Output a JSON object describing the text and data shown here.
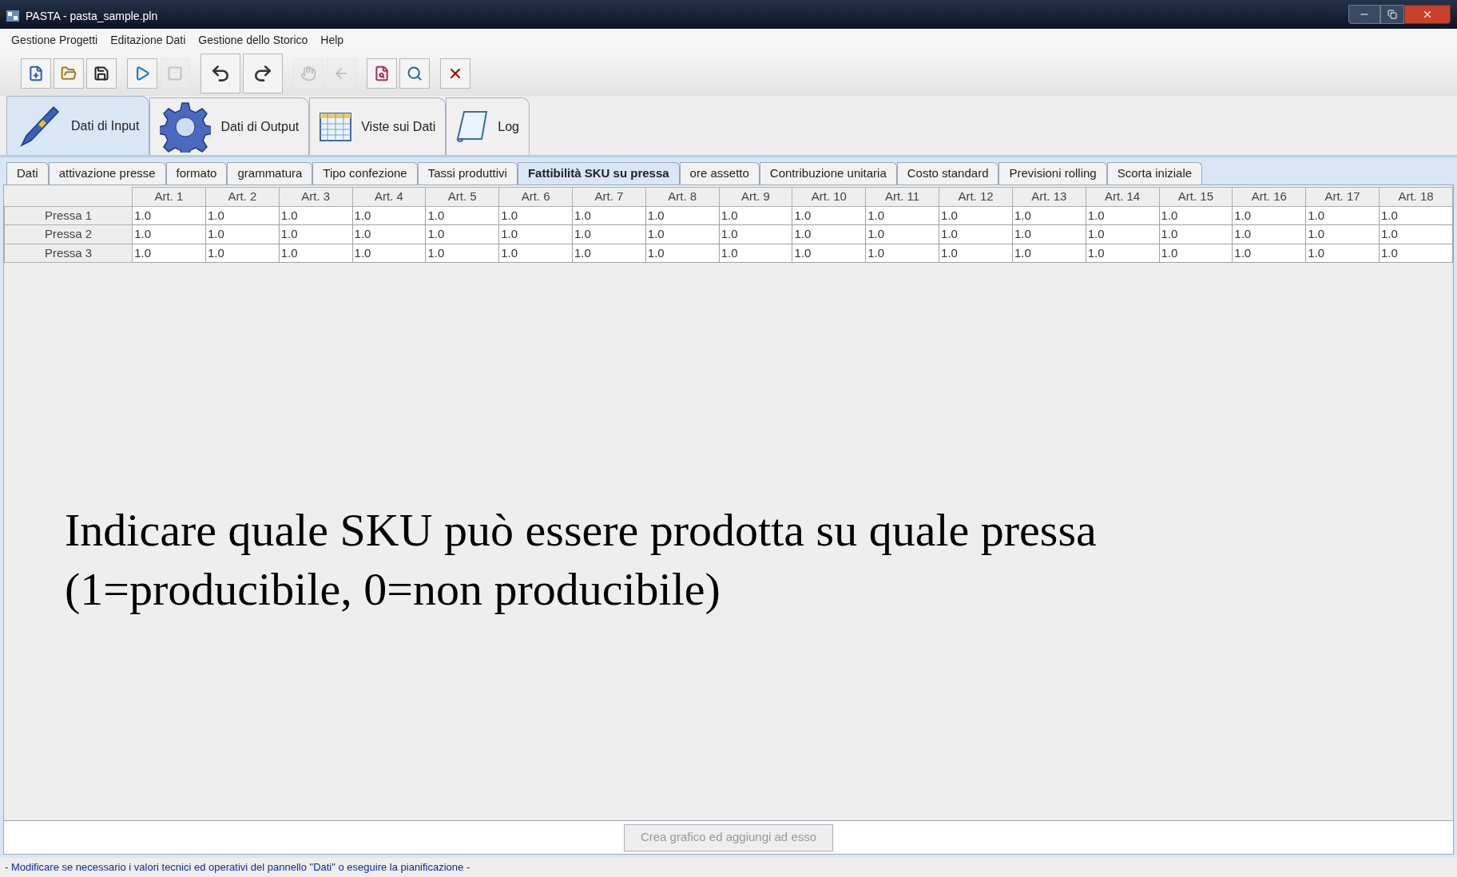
{
  "window": {
    "title": "PASTA - pasta_sample.pln"
  },
  "menu": [
    "Gestione Progetti",
    "Editazione Dati",
    "Gestione dello Storico",
    "Help"
  ],
  "toolbar": [
    {
      "kind": "new",
      "disabled": false
    },
    {
      "kind": "open",
      "disabled": false
    },
    {
      "kind": "save",
      "disabled": false
    },
    {
      "kind": "run",
      "disabled": false
    },
    {
      "kind": "stop",
      "disabled": true
    },
    {
      "kind": "undo",
      "disabled": false
    },
    {
      "kind": "redo",
      "disabled": false
    },
    {
      "kind": "back",
      "disabled": true
    },
    {
      "kind": "forward",
      "disabled": true
    },
    {
      "kind": "preview",
      "disabled": false
    },
    {
      "kind": "search",
      "disabled": false
    },
    {
      "kind": "close",
      "disabled": false
    }
  ],
  "main_tabs": [
    {
      "label": "Dati di Input",
      "kind": "pen",
      "selected": true
    },
    {
      "label": "Dati di Output",
      "kind": "gear",
      "selected": false
    },
    {
      "label": "Viste sui Dati",
      "kind": "grid",
      "selected": false
    },
    {
      "label": "Log",
      "kind": "scroll",
      "selected": false
    }
  ],
  "sub_tabs": [
    {
      "label": "Dati",
      "selected": false
    },
    {
      "label": "attivazione presse",
      "selected": false
    },
    {
      "label": "formato",
      "selected": false
    },
    {
      "label": "grammatura",
      "selected": false
    },
    {
      "label": "Tipo confezione",
      "selected": false
    },
    {
      "label": "Tassi produttivi",
      "selected": false
    },
    {
      "label": "Fattibilità SKU su pressa",
      "selected": true
    },
    {
      "label": "ore assetto",
      "selected": false
    },
    {
      "label": "Contribuzione unitaria",
      "selected": false
    },
    {
      "label": "Costo standard",
      "selected": false
    },
    {
      "label": "Previsioni rolling",
      "selected": false
    },
    {
      "label": "Scorta iniziale",
      "selected": false
    }
  ],
  "table": {
    "columns": [
      "Art. 1",
      "Art. 2",
      "Art. 3",
      "Art. 4",
      "Art. 5",
      "Art. 6",
      "Art. 7",
      "Art. 8",
      "Art. 9",
      "Art. 10",
      "Art. 11",
      "Art. 12",
      "Art. 13",
      "Art. 14",
      "Art. 15",
      "Art. 16",
      "Art. 17",
      "Art. 18"
    ],
    "rows": [
      {
        "label": "Pressa 1",
        "cells": [
          "1.0",
          "1.0",
          "1.0",
          "1.0",
          "1.0",
          "1.0",
          "1.0",
          "1.0",
          "1.0",
          "1.0",
          "1.0",
          "1.0",
          "1.0",
          "1.0",
          "1.0",
          "1.0",
          "1.0",
          "1.0"
        ]
      },
      {
        "label": "Pressa 2",
        "cells": [
          "1.0",
          "1.0",
          "1.0",
          "1.0",
          "1.0",
          "1.0",
          "1.0",
          "1.0",
          "1.0",
          "1.0",
          "1.0",
          "1.0",
          "1.0",
          "1.0",
          "1.0",
          "1.0",
          "1.0",
          "1.0"
        ]
      },
      {
        "label": "Pressa 3",
        "cells": [
          "1.0",
          "1.0",
          "1.0",
          "1.0",
          "1.0",
          "1.0",
          "1.0",
          "1.0",
          "1.0",
          "1.0",
          "1.0",
          "1.0",
          "1.0",
          "1.0",
          "1.0",
          "1.0",
          "1.0",
          "1.0"
        ]
      }
    ]
  },
  "caption": [
    "Indicare quale SKU può essere prodotta su quale pressa",
    "(1=producibile, 0=non producibile)"
  ],
  "chart_button": {
    "label": "Crea grafico ed aggiungi ad esso",
    "disabled": true
  },
  "status_bar": "- Modificare se necessario i valori tecnici ed operativi del pannello \"Dati\" o eseguire la pianificazione -"
}
